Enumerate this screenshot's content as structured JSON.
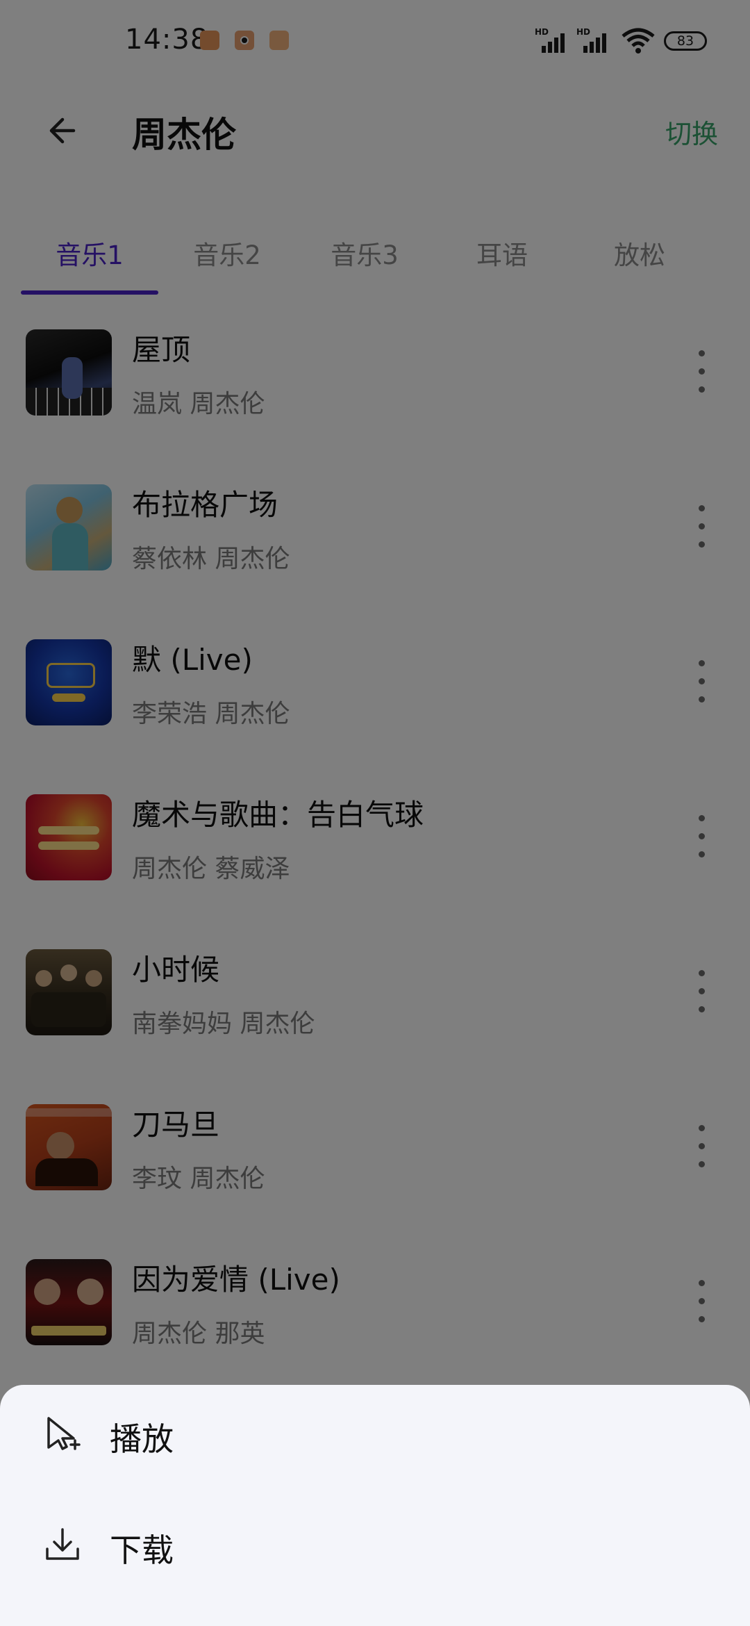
{
  "status_bar": {
    "time": "14:38",
    "battery": "83",
    "signal_label": "HD"
  },
  "header": {
    "title": "周杰伦",
    "switch_label": "切换"
  },
  "tabs": [
    {
      "label": "音乐1",
      "active": true
    },
    {
      "label": "音乐2",
      "active": false
    },
    {
      "label": "音乐3",
      "active": false
    },
    {
      "label": "耳语",
      "active": false
    },
    {
      "label": "放松",
      "active": false
    }
  ],
  "songs": [
    {
      "title": "屋顶",
      "artists": "温岚 周杰伦"
    },
    {
      "title": "布拉格广场",
      "artists": "蔡依林 周杰伦"
    },
    {
      "title": "默 (Live)",
      "artists": "李荣浩 周杰伦"
    },
    {
      "title": "魔术与歌曲：告白气球",
      "artists": "周杰伦 蔡威泽"
    },
    {
      "title": "小时候",
      "artists": "南拳妈妈 周杰伦"
    },
    {
      "title": "刀马旦",
      "artists": "李玟 周杰伦"
    },
    {
      "title": "因为爱情 (Live)",
      "artists": "周杰伦 那英"
    }
  ],
  "sheet": {
    "play_label": "播放",
    "download_label": "下载"
  },
  "colors": {
    "accent": "#4a22c8",
    "switch": "#38a36a",
    "sheet_bg": "#f4f5fa"
  }
}
